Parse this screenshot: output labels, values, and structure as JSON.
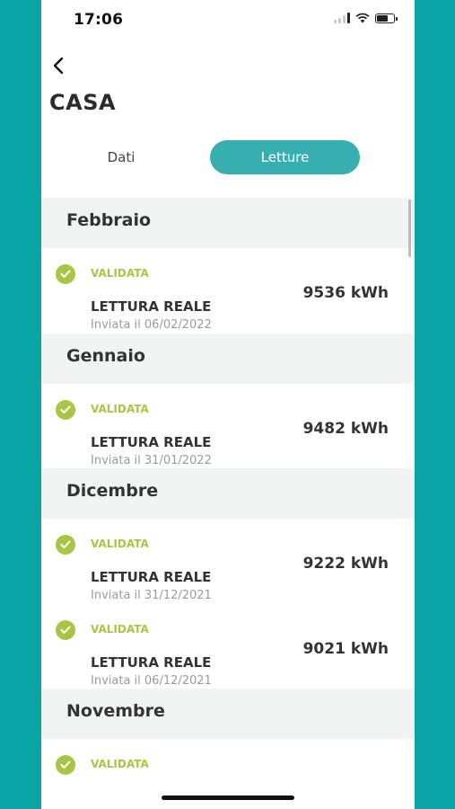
{
  "status_bar": {
    "time": "17:06"
  },
  "header": {
    "title": "CASA"
  },
  "tabs": [
    {
      "label": "Dati",
      "active": false
    },
    {
      "label": "Letture",
      "active": true
    }
  ],
  "months": [
    {
      "name": "Febbraio",
      "readings": [
        {
          "status": "VALIDATA",
          "type": "LETTURA REALE",
          "sent": "Inviata il 06/02/2022",
          "value": "9536 kWh"
        }
      ]
    },
    {
      "name": "Gennaio",
      "readings": [
        {
          "status": "VALIDATA",
          "type": "LETTURA REALE",
          "sent": "Inviata il 31/01/2022",
          "value": "9482 kWh"
        }
      ]
    },
    {
      "name": "Dicembre",
      "readings": [
        {
          "status": "VALIDATA",
          "type": "LETTURA REALE",
          "sent": "Inviata il 31/12/2021",
          "value": "9222 kWh"
        },
        {
          "status": "VALIDATA",
          "type": "LETTURA REALE",
          "sent": "Inviata il 06/12/2021",
          "value": "9021 kWh"
        }
      ]
    },
    {
      "name": "Novembre",
      "readings": [
        {
          "status": "VALIDATA",
          "type": "",
          "sent": "",
          "value": ""
        }
      ]
    }
  ],
  "colors": {
    "accent": "#37aeb0",
    "validated": "#a9c545",
    "background": "#0aa3a6"
  }
}
